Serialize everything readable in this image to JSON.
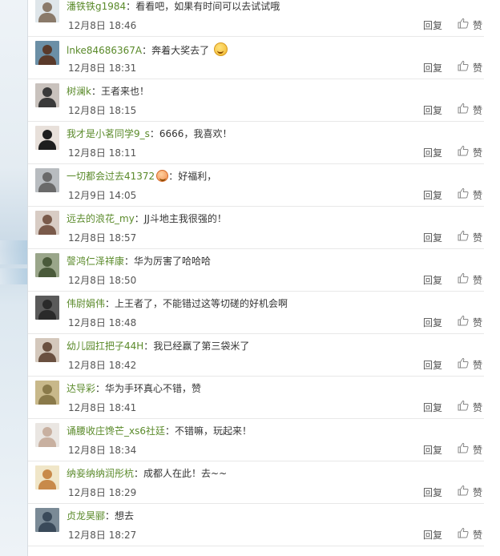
{
  "comments": [
    {
      "user": "潘铁铁g1984",
      "text": "看看吧，如果有时间可以去试试哦",
      "emoji": "",
      "time": "12月8日 18:46",
      "avatar_color": "#8a7a6a",
      "avatar_bg": "#dfe6ea"
    },
    {
      "user": "lnke84686367A",
      "text": "奔着大奖去了",
      "emoji": "grin-emoji",
      "time": "12月8日 18:31",
      "avatar_color": "#5a3a2a",
      "avatar_bg": "#6b8fa6"
    },
    {
      "user": "树澜k",
      "text": "王者来也！",
      "emoji": "",
      "time": "12月8日 18:15",
      "avatar_color": "#3a3a3a",
      "avatar_bg": "#c9c2bd"
    },
    {
      "user": "我才是小茗同学9_s",
      "text": "6666，我喜欢！",
      "emoji": "",
      "time": "12月8日 18:11",
      "avatar_color": "#1e1e1e",
      "avatar_bg": "#e8e0da"
    },
    {
      "user": "一切都会过去41372",
      "text": "好福利，",
      "emoji": "blush-emoji",
      "time": "12月9日 14:05",
      "avatar_color": "#6a6a6a",
      "avatar_bg": "#b8bcc0"
    },
    {
      "user": "远去的浪花_my",
      "text": "JJ斗地主我很强的！",
      "emoji": "",
      "time": "12月8日 18:57",
      "avatar_color": "#7a5a4a",
      "avatar_bg": "#d8ccc4"
    },
    {
      "user": "謦鸿仁泽祥康",
      "text": "华为厉害了哈哈哈",
      "emoji": "",
      "time": "12月8日 18:50",
      "avatar_color": "#4a5a3a",
      "avatar_bg": "#9aa68a"
    },
    {
      "user": "伟尉娟伟",
      "text": "上王者了，不能错过这等切磋的好机会啊",
      "emoji": "",
      "time": "12月8日 18:48",
      "avatar_color": "#2a2a2a",
      "avatar_bg": "#5a5a5a"
    },
    {
      "user": "幼儿园扛把子44H",
      "text": "我已经赢了第三袋米了",
      "emoji": "",
      "time": "12月8日 18:42",
      "avatar_color": "#6a5040",
      "avatar_bg": "#d4c8bc"
    },
    {
      "user": "达导彩",
      "text": "华为手环真心不错，赞",
      "emoji": "",
      "time": "12月8日 18:41",
      "avatar_color": "#8a7a4a",
      "avatar_bg": "#c8b88a"
    },
    {
      "user": "诵腰收庄馋芒_xs6社廷",
      "text": "不错嘛，玩起来！",
      "emoji": "",
      "time": "12月8日 18:34",
      "avatar_color": "#c8b0a0",
      "avatar_bg": "#eae6e2"
    },
    {
      "user": "纳妾纳纳润彤杭",
      "text": "成都人在此！去~~",
      "emoji": "",
      "time": "12月8日 18:29",
      "avatar_color": "#c88a4a",
      "avatar_bg": "#f0e6c8"
    },
    {
      "user": "贞龙昊郦",
      "text": "想去",
      "emoji": "",
      "time": "12月8日 18:27",
      "avatar_color": "#3a4a5a",
      "avatar_bg": "#7a8a96"
    }
  ],
  "labels": {
    "reply": "回复",
    "like": "赞",
    "colon": "："
  },
  "colors": {
    "username": "#5a8a2a",
    "text": "#333333",
    "meta": "#555555",
    "divider": "#e8e8e8"
  }
}
